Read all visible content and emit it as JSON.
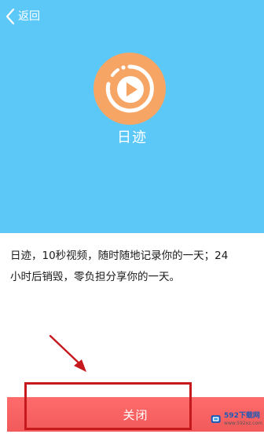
{
  "header": {
    "back_label": "返回"
  },
  "app": {
    "name": "日迹",
    "accent_color": "#f7a565",
    "header_color": "#5cc8f8"
  },
  "description": {
    "line1": "日迹，10秒视频，随时随地记录你的一天；24",
    "line2": "小时后销毁，零负担分享你的一天。"
  },
  "footer": {
    "close_label": "关闭",
    "button_color": "#f25a5a"
  },
  "watermark": {
    "top": "592下载网",
    "bottom": "www.592xz.com"
  }
}
